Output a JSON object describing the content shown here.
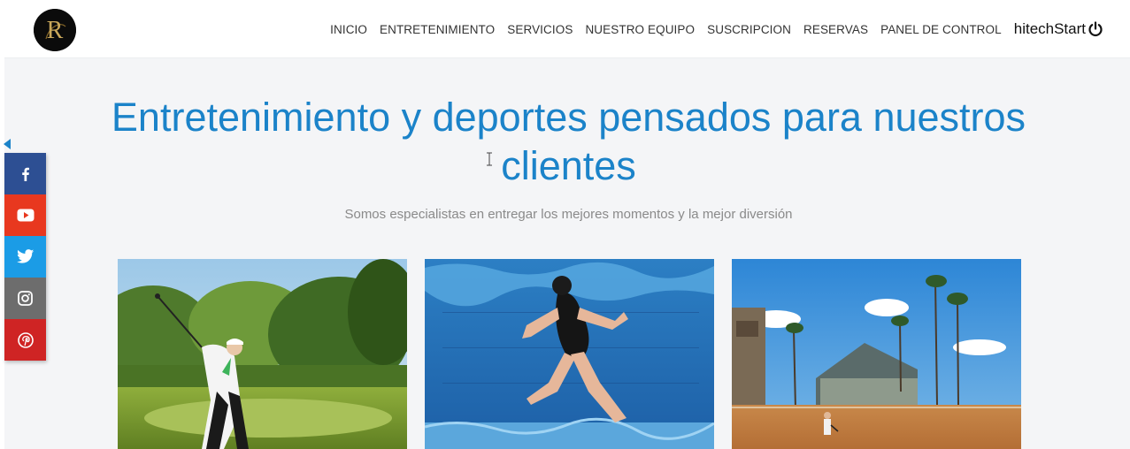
{
  "header": {
    "logo_letter": "R",
    "nav_items": [
      "INICIO",
      "ENTRETENIMIENTO",
      "SERVICIOS",
      "NUESTRO EQUIPO",
      "SUSCRIPCION",
      "RESERVAS",
      "PANEL DE CONTROL"
    ],
    "brand": "hitechStart",
    "brand_icon": "power-icon"
  },
  "hero": {
    "title": "Entretenimiento y deportes pensados para nuestros clientes",
    "subtitle": "Somos especialistas en entregar los mejores momentos y la mejor diversión"
  },
  "cards": [
    {
      "image": "golf-photo"
    },
    {
      "image": "swimming-photo"
    },
    {
      "image": "tennis-photo"
    }
  ],
  "social": [
    {
      "icon": "facebook-icon",
      "color": "#2d4f93"
    },
    {
      "icon": "youtube-icon",
      "color": "#e8381f"
    },
    {
      "icon": "twitter-icon",
      "color": "#1b9ce6"
    },
    {
      "icon": "instagram-icon",
      "color": "#6d6d6d"
    },
    {
      "icon": "pinterest-icon",
      "color": "#cf2424"
    }
  ],
  "colors": {
    "accent": "#1b83c9",
    "subtitle": "#8a8a8a"
  }
}
